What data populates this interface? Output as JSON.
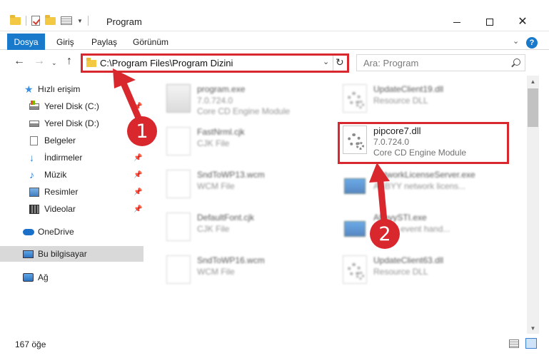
{
  "window": {
    "title": "Program",
    "controls": [
      "minimize",
      "maximize",
      "close"
    ]
  },
  "ribbon": {
    "tabs": [
      {
        "label": "Dosya",
        "active": true
      },
      {
        "label": "Giriş"
      },
      {
        "label": "Paylaş"
      },
      {
        "label": "Görünüm"
      }
    ],
    "help": "?",
    "collapse_icon": "chevron-down-icon"
  },
  "nav": {
    "address_path": "C:\\Program Files\\Program Dizini",
    "search_placeholder": "Ara: Program"
  },
  "sidebar": {
    "items": [
      {
        "label": "Hızlı erişim",
        "icon": "star-icon",
        "pinned": false
      },
      {
        "label": "Yerel Disk (C:)",
        "icon": "drive-icon",
        "pinned": true
      },
      {
        "label": "Yerel Disk (D:)",
        "icon": "drive-icon",
        "pinned": true
      },
      {
        "label": "Belgeler",
        "icon": "documents-icon",
        "pinned": true
      },
      {
        "label": "İndirmeler",
        "icon": "download-icon",
        "pinned": true
      },
      {
        "label": "Müzik",
        "icon": "music-icon",
        "pinned": true
      },
      {
        "label": "Resimler",
        "icon": "pictures-icon",
        "pinned": true
      },
      {
        "label": "Videolar",
        "icon": "videos-icon",
        "pinned": true
      },
      {
        "label": "OneDrive",
        "icon": "onedrive-icon",
        "pinned": false
      },
      {
        "label": "Bu bilgisayar",
        "icon": "this-pc-icon",
        "selected": true
      },
      {
        "label": "Ağ",
        "icon": "network-icon",
        "pinned": false
      }
    ]
  },
  "files": {
    "left_column": [
      {
        "name": "program.exe",
        "line1": "7.0.724.0",
        "line2": "Core CD Engine Module"
      },
      {
        "name": "FastNrml.cjk",
        "line1": "CJK File",
        "line2": ""
      },
      {
        "name": "SndToWP13.wcm",
        "line1": "WCM File",
        "line2": ""
      },
      {
        "name": "DefaultFont.cjk",
        "line1": "CJK File",
        "line2": ""
      },
      {
        "name": "SndToWP16.wcm",
        "line1": "WCM File",
        "line2": ""
      }
    ],
    "right_column": [
      {
        "name": "UpdateClient19.dll",
        "line1": "Resource DLL",
        "line2": ""
      },
      {
        "name": "pipcore7.dll",
        "line1": "7.0.724.0",
        "line2": "Core CD Engine Module"
      },
      {
        "name": "NetworkLicenseServer.exe",
        "line1": "ABBYY network licens...",
        "line2": ""
      },
      {
        "name": "AbbyySTI.exe",
        "line1": "STI cd event hand...",
        "line2": ""
      },
      {
        "name": "UpdateClient63.dll",
        "line1": "Resource DLL",
        "line2": ""
      }
    ]
  },
  "status": {
    "count": "167 öğe"
  },
  "annotations": {
    "badge1": "1",
    "badge2": "2",
    "color": "#d9272e"
  }
}
